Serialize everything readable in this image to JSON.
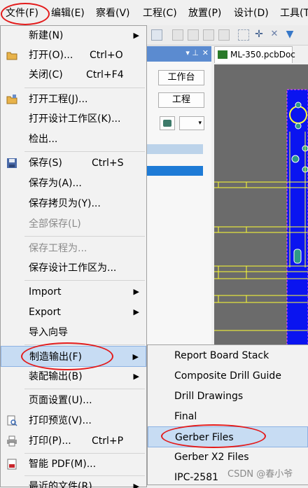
{
  "menubar": {
    "items": [
      "文件(F)",
      "编辑(E)",
      "察看(V)",
      "工程(C)",
      "放置(P)",
      "设计(D)",
      "工具(T"
    ]
  },
  "panel": {
    "buttons": [
      "工作台",
      "工程"
    ]
  },
  "document_tab": {
    "label": "ML-350.pcbDoc"
  },
  "file_menu": {
    "items": [
      {
        "label": "新建(N)",
        "icon": "none",
        "submenu": true
      },
      {
        "label": "打开(O)...",
        "shortcut": "Ctrl+O",
        "icon": "open-folder-icon"
      },
      {
        "label": "关闭(C)",
        "shortcut": "Ctrl+F4"
      },
      {
        "label": "打开工程(J)...",
        "icon": "open-project-icon"
      },
      {
        "label": "打开设计工作区(K)..."
      },
      {
        "label": "检出..."
      },
      {
        "label": "保存(S)",
        "shortcut": "Ctrl+S",
        "icon": "save-icon"
      },
      {
        "label": "保存为(A)..."
      },
      {
        "label": "保存拷贝为(Y)..."
      },
      {
        "label": "全部保存(L)",
        "disabled": true
      },
      {
        "label": "保存工程为...",
        "disabled": true
      },
      {
        "label": "保存设计工作区为..."
      },
      {
        "label": "Import",
        "submenu": true
      },
      {
        "label": "Export",
        "submenu": true
      },
      {
        "label": "导入向导"
      },
      {
        "label": "制造输出(F)",
        "submenu": true,
        "highlighted": true
      },
      {
        "label": "装配输出(B)",
        "submenu": true
      },
      {
        "label": "页面设置(U)..."
      },
      {
        "label": "打印预览(V)...",
        "icon": "print-preview-icon"
      },
      {
        "label": "打印(P)...",
        "shortcut": "Ctrl+P",
        "icon": "printer-icon"
      },
      {
        "label": "智能 PDF(M)...",
        "icon": "pdf-icon"
      },
      {
        "label": "最近的文件(R)",
        "submenu": true
      }
    ]
  },
  "fab_submenu": {
    "items": [
      {
        "label": "Report Board Stack"
      },
      {
        "label": "Composite Drill Guide"
      },
      {
        "label": "Drill Drawings"
      },
      {
        "label": "Final"
      },
      {
        "label": "Gerber Files",
        "highlighted": true
      },
      {
        "label": "Gerber X2 Files"
      },
      {
        "label": "IPC-2581"
      }
    ]
  },
  "watermark": "CSDN @春小爷",
  "colors": {
    "annotation_circle": "#e31b1b",
    "highlight": "#c7dcf3",
    "pcb_blue": "#0a14f0",
    "pcb_yellow": "#ffff33",
    "pcb_teal": "#2e9a86"
  }
}
